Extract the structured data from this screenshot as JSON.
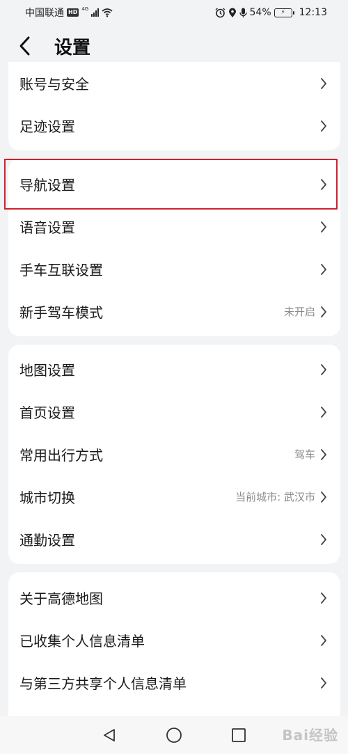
{
  "status_bar": {
    "carrier": "中国联通",
    "hd": "HD",
    "network": "4G",
    "battery": "54%",
    "time": "12:13"
  },
  "header": {
    "title": "设置"
  },
  "groups": [
    {
      "items": [
        {
          "label": "账号与安全",
          "value": ""
        },
        {
          "label": "足迹设置",
          "value": ""
        }
      ]
    },
    {
      "items": [
        {
          "label": "导航设置",
          "value": ""
        },
        {
          "label": "语音设置",
          "value": ""
        },
        {
          "label": "手车互联设置",
          "value": ""
        },
        {
          "label": "新手驾车模式",
          "value": "未开启"
        }
      ]
    },
    {
      "items": [
        {
          "label": "地图设置",
          "value": ""
        },
        {
          "label": "首页设置",
          "value": ""
        },
        {
          "label": "常用出行方式",
          "value": "驾车"
        },
        {
          "label": "城市切换",
          "value": "当前城市: 武汉市"
        },
        {
          "label": "通勤设置",
          "value": ""
        }
      ]
    },
    {
      "items": [
        {
          "label": "关于高德地图",
          "value": ""
        },
        {
          "label": "已收集个人信息清单",
          "value": ""
        },
        {
          "label": "与第三方共享个人信息清单",
          "value": ""
        }
      ]
    }
  ],
  "highlight_color": "#d0212a",
  "watermark": "Bai经验"
}
